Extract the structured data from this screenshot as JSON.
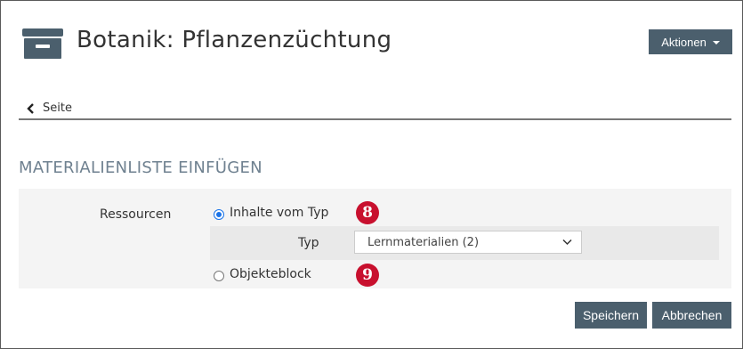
{
  "header": {
    "icon": "archive-box-icon",
    "title": "Botanik: Pflanzenzüchtung",
    "actions_label": "Aktionen"
  },
  "nav": {
    "back_label": "Seite",
    "back_icon": "chevron-left-icon"
  },
  "section": {
    "title": "MATERIALIENLISTE EINFÜGEN"
  },
  "form": {
    "resources_label": "Ressourcen",
    "option_content_type": {
      "label": "Inhalte vom Typ",
      "selected": true
    },
    "type_label": "Typ",
    "type_select_value": "Lernmaterialien (2)",
    "option_object_block": {
      "label": "Objekteblock",
      "selected": false
    }
  },
  "callouts": {
    "badge_8": "8",
    "badge_9": "9"
  },
  "buttons": {
    "save_label": "Speichern",
    "cancel_label": "Abbrechen"
  },
  "colors": {
    "primary_button": "#4b5f6d",
    "section_title": "#6f8190",
    "callout_badge": "#c8102e",
    "radio_selected": "#1a73e8"
  }
}
